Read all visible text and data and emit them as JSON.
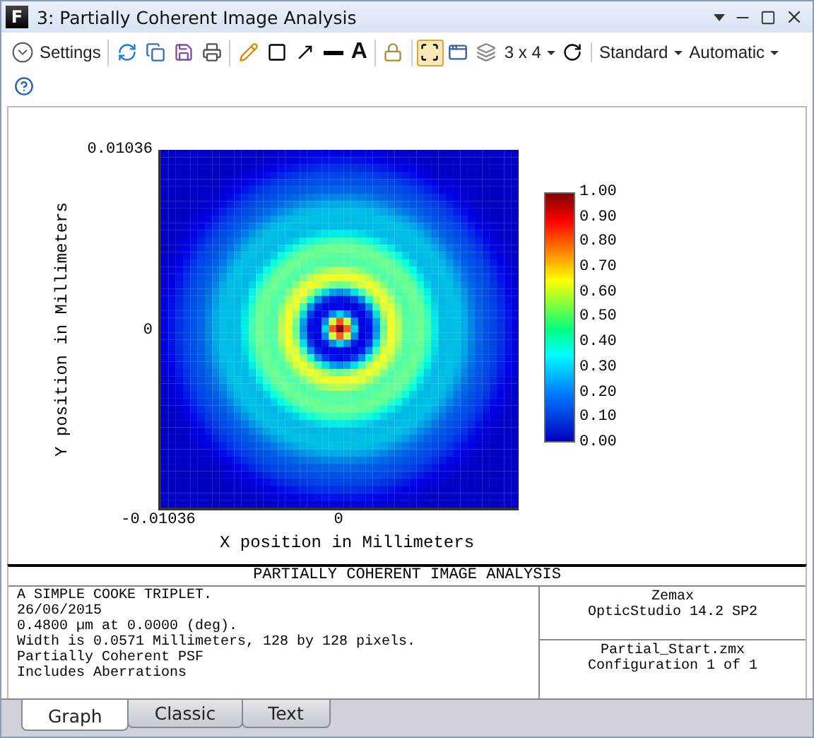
{
  "window": {
    "app_icon": "F",
    "title": "3: Partially Coherent Image Analysis"
  },
  "toolbar": {
    "groups": [
      [
        {
          "kind": "settings",
          "label": "Settings"
        }
      ],
      [
        {
          "kind": "refresh",
          "on": false
        },
        {
          "kind": "copy",
          "on": false
        },
        {
          "kind": "save",
          "on": false
        },
        {
          "kind": "print",
          "on": false
        }
      ],
      [
        {
          "kind": "pencil",
          "on": false
        },
        {
          "kind": "rectangle",
          "on": false
        },
        {
          "kind": "arrow",
          "on": false
        },
        {
          "kind": "line",
          "on": false
        },
        {
          "kind": "text",
          "label": "A"
        }
      ],
      [
        {
          "kind": "lock",
          "on": false
        }
      ],
      [
        {
          "kind": "fit",
          "on": true
        },
        {
          "kind": "window",
          "on": false
        },
        {
          "kind": "layers",
          "on": false
        },
        {
          "kind": "dropdown",
          "label": "3 x 4"
        },
        {
          "kind": "rotate",
          "on": false
        }
      ],
      [
        {
          "kind": "dropdown",
          "label": "Standard"
        },
        {
          "kind": "dropdown",
          "label": "Automatic"
        }
      ]
    ],
    "second_row": [
      {
        "kind": "help",
        "on": false
      }
    ]
  },
  "plot": {
    "y_label": "Y position in Millimeters",
    "x_label": "X position in Millimeters",
    "y_ticks": [
      "0.01036",
      "0"
    ],
    "x_ticks": [
      "-0.01036",
      "0"
    ],
    "colorbar_ticks": [
      "1.00",
      "0.90",
      "0.80",
      "0.70",
      "0.60",
      "0.50",
      "0.40",
      "0.30",
      "0.20",
      "0.10",
      "0.00"
    ]
  },
  "info": {
    "title": "PARTIALLY COHERENT IMAGE ANALYSIS",
    "left_lines": [
      "A SIMPLE COOKE TRIPLET.",
      "26/06/2015",
      "0.4800 µm at 0.0000 (deg).",
      "Width is 0.0571 Millimeters, 128 by 128 pixels.",
      "Partially Coherent PSF",
      "Includes Aberrations"
    ],
    "right_top_lines": [
      "Zemax",
      "OpticStudio 14.2 SP2"
    ],
    "right_bottom_lines": [
      "Partial_Start.zmx",
      "Configuration 1 of 1"
    ]
  },
  "tabs": [
    {
      "label": "Graph",
      "selected": true
    },
    {
      "label": "Classic",
      "selected": false
    },
    {
      "label": "Text",
      "selected": false
    }
  ]
}
